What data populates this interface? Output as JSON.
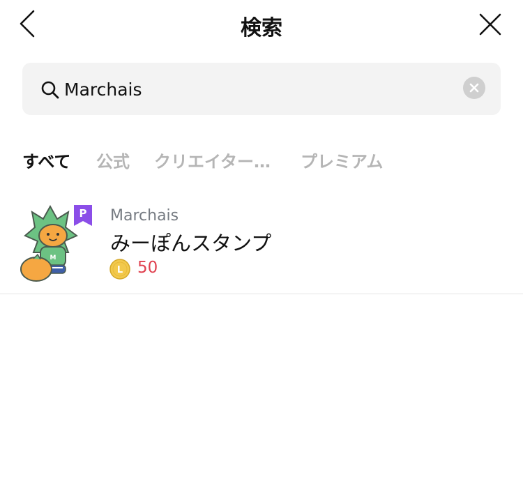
{
  "header": {
    "title": "検索"
  },
  "search": {
    "query": "Marchais",
    "clear_label": "clear"
  },
  "tabs": [
    {
      "label": "すべて",
      "active": true
    },
    {
      "label": "公式",
      "active": false
    },
    {
      "label": "クリエイター…",
      "active": false
    },
    {
      "label": "プレミアム",
      "active": false
    }
  ],
  "results": [
    {
      "author": "Marchais",
      "name": "みーぽんスタンプ",
      "badge": "P",
      "coin_letter": "L",
      "price": "50"
    }
  ],
  "colors": {
    "search_bg": "#f3f3f3",
    "tab_inactive": "#b5b5b5",
    "price_red": "#e0414f",
    "premium_purple": "#8b4ee8",
    "coin_gold": "#f2c94c",
    "author_gray": "#767b82"
  },
  "icons": {
    "back": "chevron-left-icon",
    "close": "close-icon",
    "search": "search-icon",
    "clear": "clear-circle-icon",
    "premium": "premium-badge-icon",
    "coin": "line-coin-icon"
  }
}
